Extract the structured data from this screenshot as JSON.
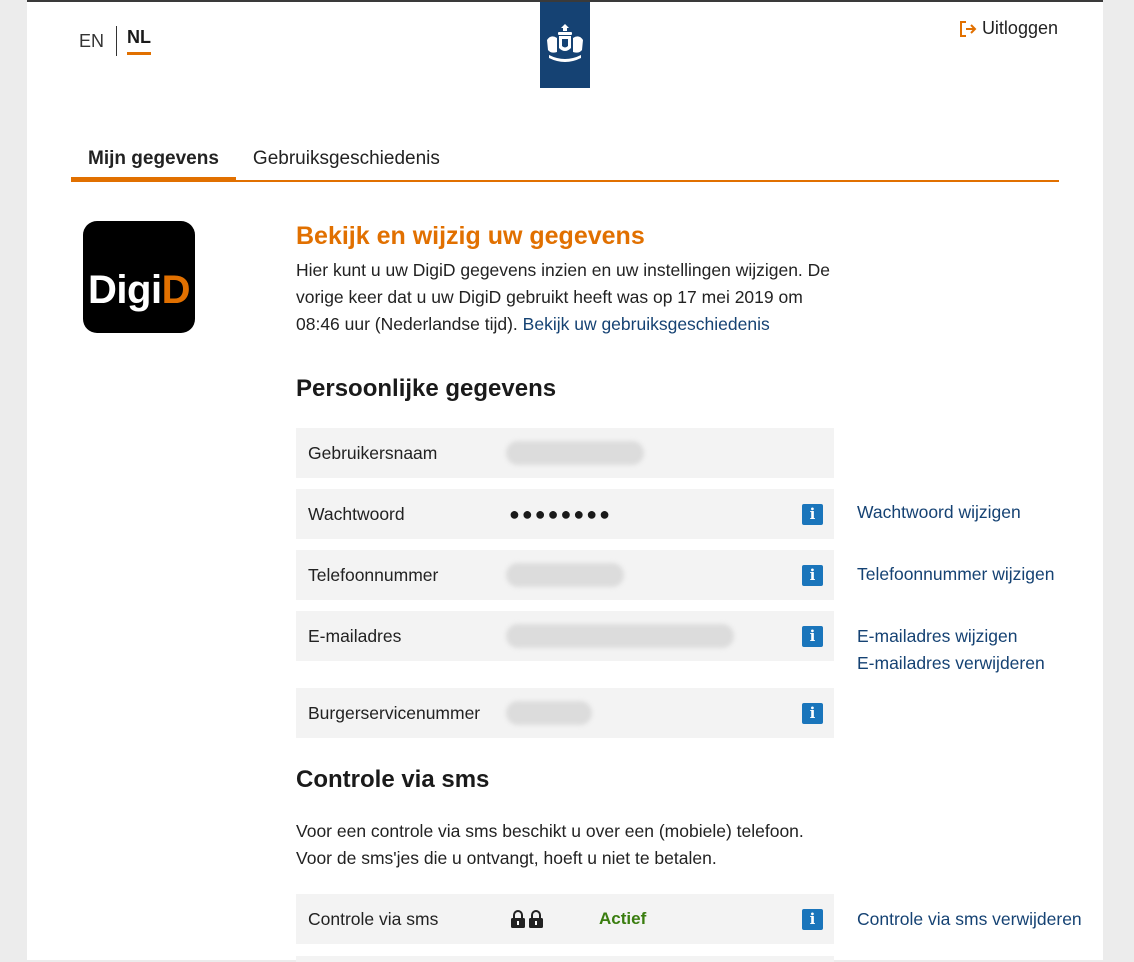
{
  "header": {
    "languages": [
      "EN",
      "NL"
    ],
    "active_language": "NL",
    "logout_label": "Uitloggen"
  },
  "tabs": [
    {
      "label": "Mijn gegevens",
      "active": true
    },
    {
      "label": "Gebruiksgeschiedenis",
      "active": false
    }
  ],
  "logo": {
    "text_white": "Digi",
    "text_orange": "D"
  },
  "intro": {
    "title": "Bekijk en wijzig uw gegevens",
    "text": "Hier kunt u uw DigiD gegevens inzien en uw instellingen wijzigen. De vorige keer dat u uw DigiD gebruikt heeft was op 17 mei 2019 om 08:46 uur (Nederlandse tijd).",
    "link": "Bekijk uw gebruiksgeschiedenis"
  },
  "personal": {
    "title": "Persoonlijke gegevens",
    "rows": [
      {
        "label": "Gebruikersnaam",
        "value_type": "blurred",
        "actions": []
      },
      {
        "label": "Wachtwoord",
        "value": "●●●●●●●●",
        "actions": [
          "Wachtwoord wijzigen"
        ]
      },
      {
        "label": "Telefoonnummer",
        "value_type": "blurred",
        "actions": [
          "Telefoonnummer wijzigen"
        ]
      },
      {
        "label": "E-mailadres",
        "value_type": "blurred",
        "actions": [
          "E-mailadres wijzigen",
          "E-mailadres verwijderen"
        ]
      },
      {
        "label": "Burgerservicenummer",
        "value_type": "blurred",
        "actions": []
      }
    ]
  },
  "sms": {
    "title": "Controle via sms",
    "text": "Voor een controle via sms beschikt u over een (mobiele) telefoon. Voor de sms'jes die u ontvangt, hoeft u niet te betalen.",
    "row_label": "Controle via sms",
    "status": "Actief",
    "action": "Controle via sms verwijderen"
  },
  "colors": {
    "accent": "#e17000",
    "link": "#154273",
    "info": "#1a75bb",
    "active": "#3a7d0f"
  }
}
